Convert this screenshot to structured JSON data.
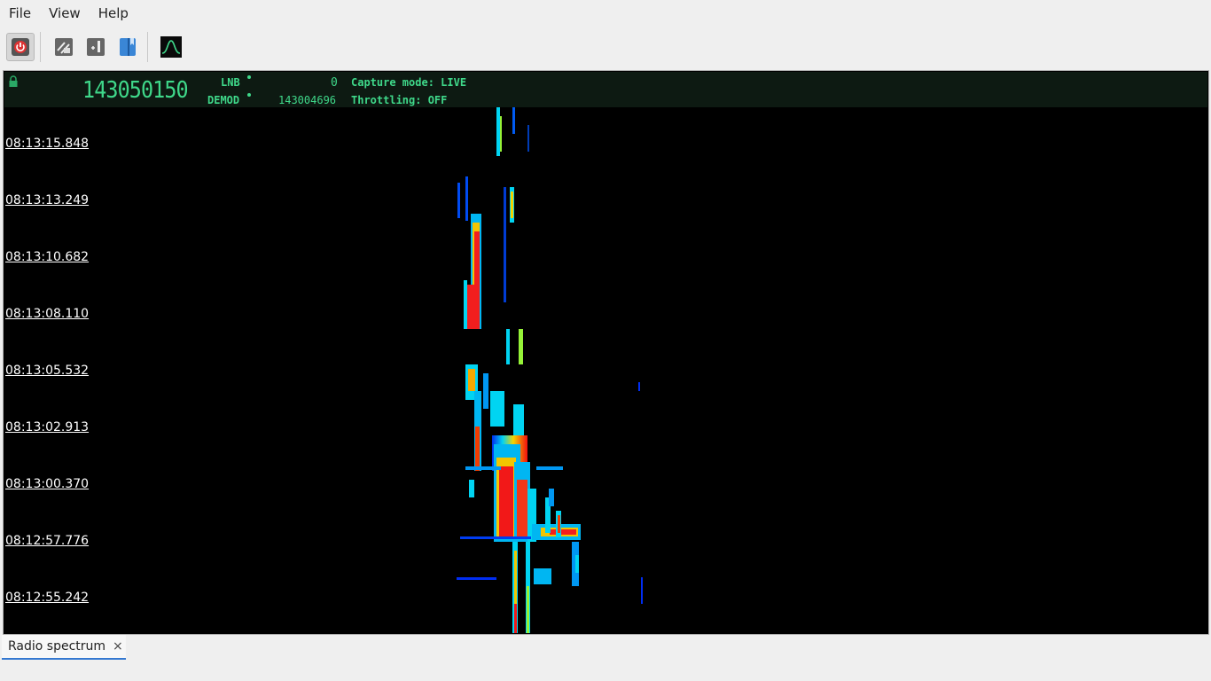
{
  "menu": [
    "File",
    "View",
    "Help"
  ],
  "toolbar": {
    "buttons": [
      {
        "name": "power-button",
        "icon": "power-icon"
      },
      {
        "name": "settings-button",
        "icon": "sliders-icon"
      },
      {
        "name": "panoramic-button",
        "icon": "panorama-icon"
      },
      {
        "name": "bookmarks-button",
        "icon": "bookmark-icon"
      },
      {
        "name": "spectrum-button",
        "icon": "spectrum-icon"
      }
    ]
  },
  "header": {
    "frequency": "143050150",
    "lnb_label": "LNB",
    "lnb_value": "0",
    "demod_label": "DEMOD",
    "demod_value": "143004696",
    "capture_mode": "Capture mode: LIVE",
    "throttling": "Throttling: OFF"
  },
  "timestamps": [
    "08:13:15.848",
    "08:13:13.249",
    "08:13:10.682",
    "08:13:08.110",
    "08:13:05.532",
    "08:13:02.913",
    "08:13:00.370",
    "08:12:57.776",
    "08:12:55.242"
  ],
  "tab": {
    "label": "Radio spectrum",
    "close": "×"
  },
  "colors": {
    "accent": "#3fd88a",
    "tab_underline": "#3478d0"
  }
}
